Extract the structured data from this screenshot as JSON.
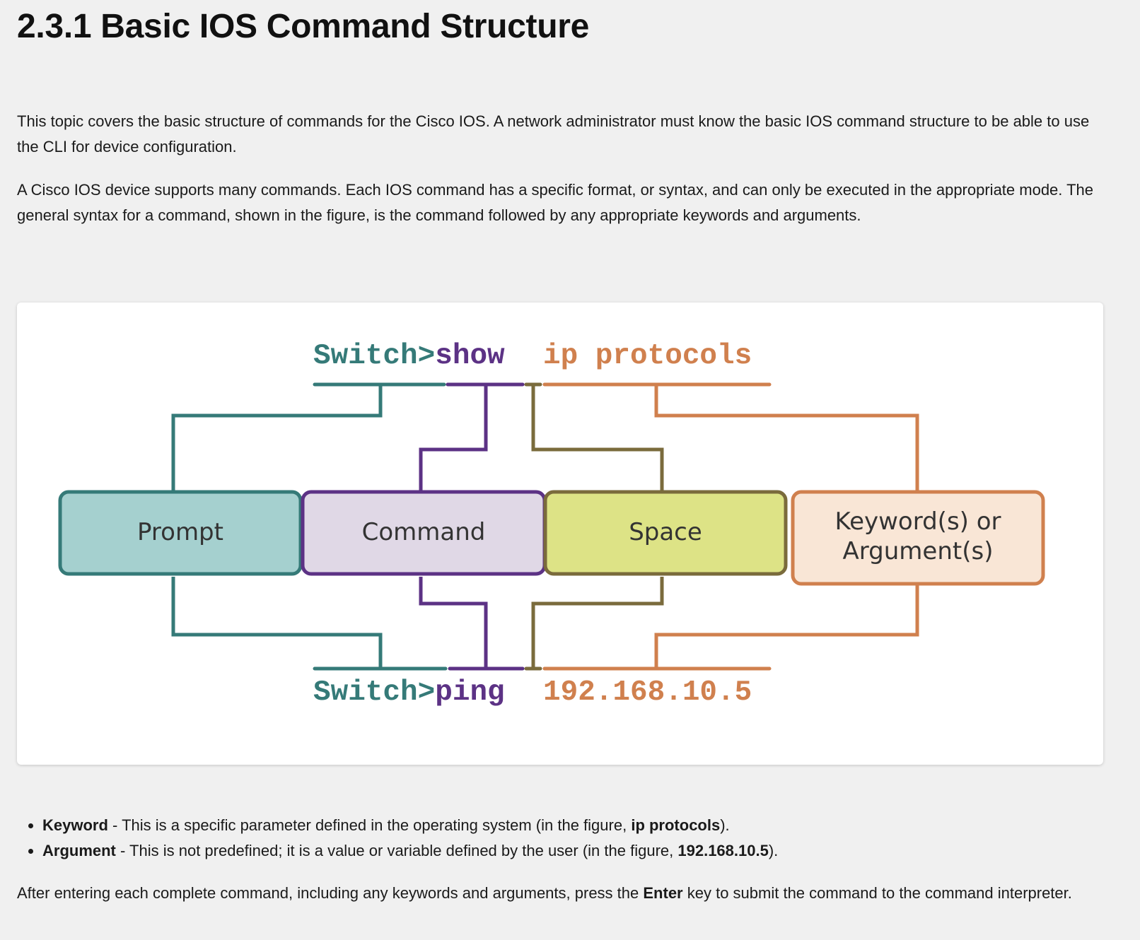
{
  "title": "2.3.1 Basic IOS Command Structure",
  "paragraphs": {
    "p1": "This topic covers the basic structure of commands for the Cisco IOS. A network administrator must know the basic IOS command structure to be able to use the CLI for device configuration.",
    "p2": "A Cisco IOS device supports many commands. Each IOS command has a specific format, or syntax, and can only be executed in the appropriate mode. The general syntax for a command, shown in the figure, is the command followed by any appropriate keywords and arguments.",
    "p3_before": "After entering each complete command, including any keywords and arguments, press the ",
    "p3_bold": "Enter",
    "p3_after": " key to submit the command to the command interpreter."
  },
  "figure": {
    "top_command": {
      "prompt": "Switch>",
      "command": "show",
      "args": "ip protocols"
    },
    "bottom_command": {
      "prompt": "Switch>",
      "command": "ping",
      "args": "192.168.10.5"
    },
    "boxes": {
      "prompt": "Prompt",
      "command": "Command",
      "space": "Space",
      "keyword_line1": "Keyword(s) or",
      "keyword_line2": "Argument(s)"
    },
    "colors": {
      "prompt": "#357a78",
      "prompt_fill": "#a5d0cf",
      "command": "#5c3285",
      "command_fill": "#e0d8e6",
      "space": "#7a6b3c",
      "space_fill": "#dde386",
      "keyword": "#d0804e",
      "keyword_fill": "#f9e6d6"
    }
  },
  "definitions": [
    {
      "term": "Keyword",
      "text": " - This is a specific parameter defined in the operating system (in the figure, ",
      "example": "ip protocols",
      "end": ")."
    },
    {
      "term": "Argument",
      "text": " - This is not predefined; it is a value or variable defined by the user (in the figure, ",
      "example": "192.168.10.5",
      "end": ")."
    }
  ]
}
